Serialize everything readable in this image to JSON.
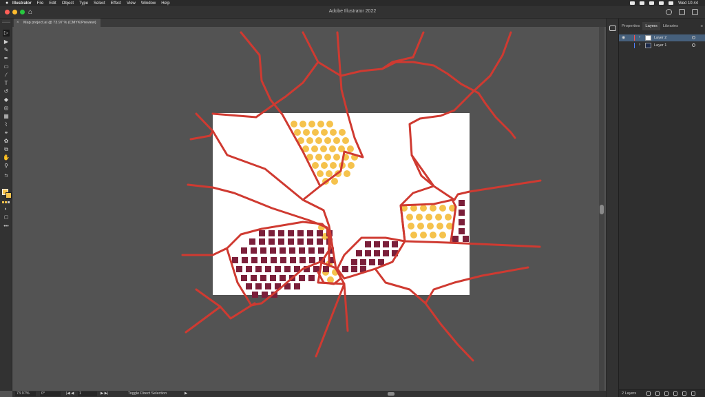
{
  "menubar": {
    "apple": "",
    "app": "Illustrator",
    "items": [
      "File",
      "Edit",
      "Object",
      "Type",
      "Select",
      "Effect",
      "View",
      "Window",
      "Help"
    ],
    "clock": "Wed 10:44"
  },
  "window": {
    "title": "Adobe Illustrator 2022"
  },
  "document_tab": {
    "label": "Map project.ai @ 73.97 % (CMYK/Preview)",
    "close": "×"
  },
  "panel": {
    "tabs": [
      "Properties",
      "Layers",
      "Libraries"
    ],
    "active_tab": "Layers",
    "menu_glyph": "≡",
    "layers": [
      {
        "name": "Layer 2",
        "color": "#ff4f4f",
        "selected": true
      },
      {
        "name": "Layer 1",
        "color": "#4f7fff",
        "selected": false
      }
    ],
    "layer_count": "2 Layers"
  },
  "status": {
    "zoom": "73.97%",
    "rotation": "0°",
    "artboard": "1",
    "tool_hint": "Toggle Direct Selection"
  },
  "colors": {
    "road": "#cf3a31",
    "dot": "#f5c24c",
    "square": "#7b1f3a",
    "artboard": "#ffffff",
    "pasteboard": "#535353",
    "fill_swatch": "#f5c24c"
  }
}
